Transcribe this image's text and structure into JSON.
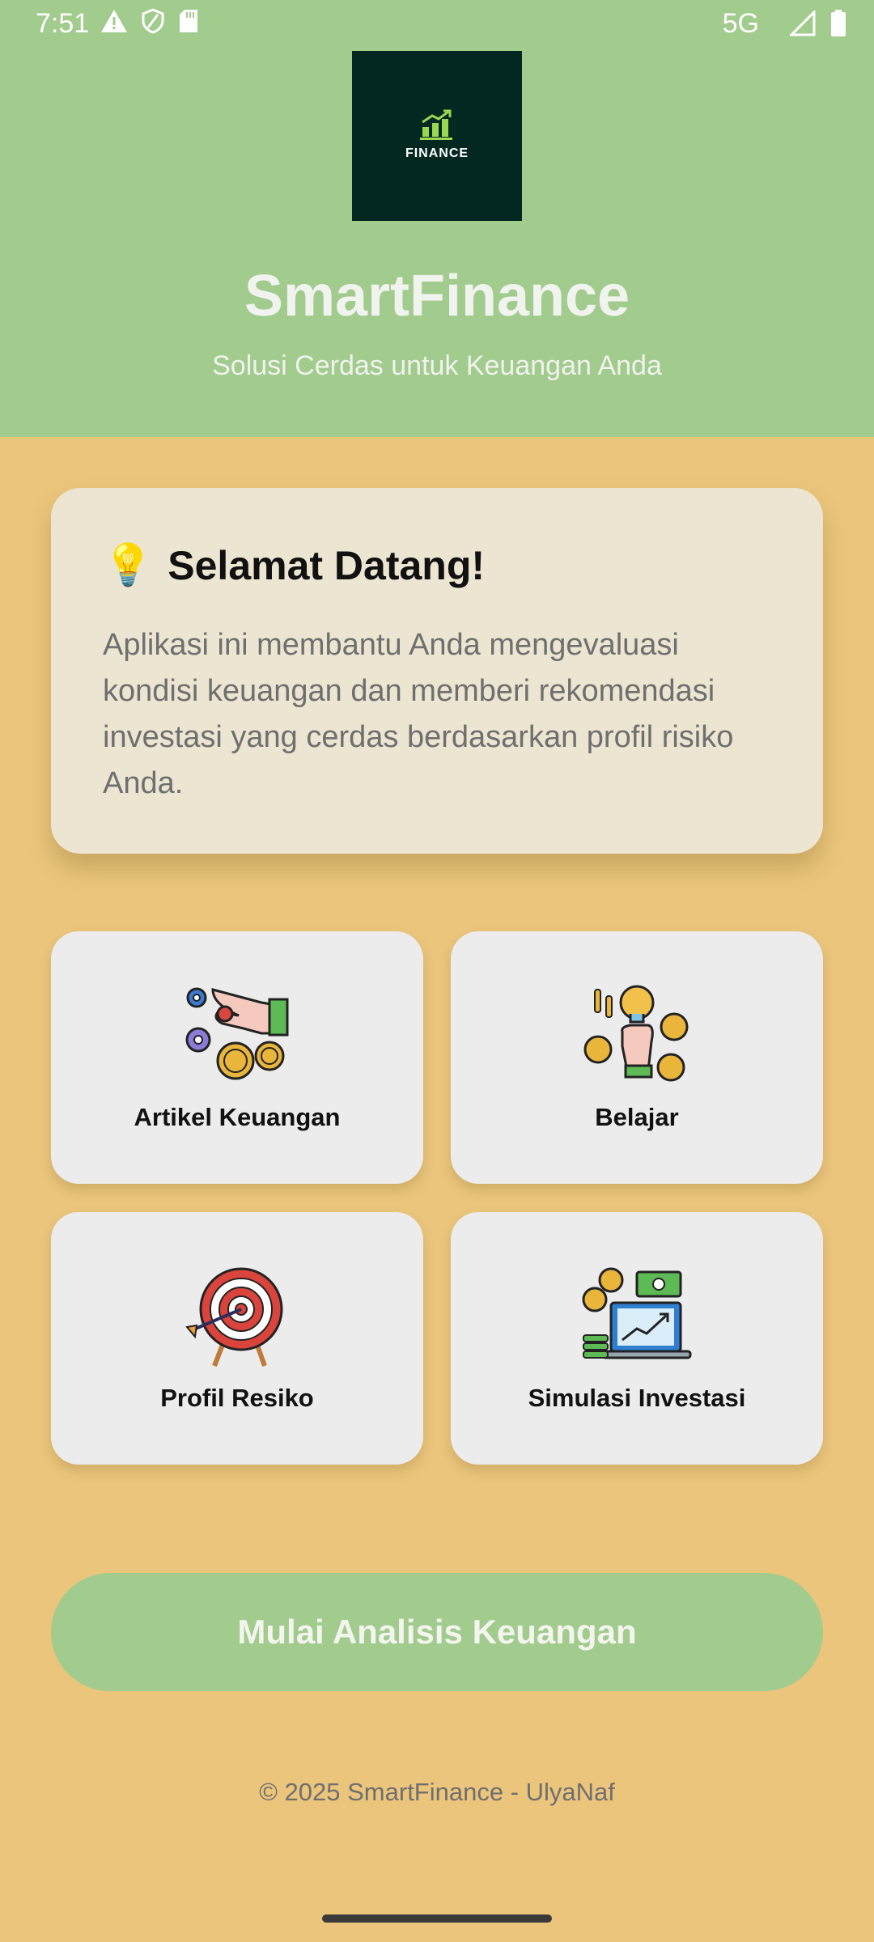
{
  "status_bar": {
    "time": "7:51",
    "network": "5G",
    "icons_left": [
      "warning-icon",
      "shield-icon",
      "sd-card-icon"
    ],
    "icons_right": [
      "signal-icon",
      "battery-icon"
    ]
  },
  "header": {
    "logo_text": "FINANCE",
    "title": "SmartFinance",
    "subtitle": "Solusi Cerdas untuk Keuangan Anda",
    "background": "#A2CB8E"
  },
  "welcome": {
    "emoji": "💡",
    "title": "Selamat Datang!",
    "body": "Aplikasi ini membantu Anda mengevaluasi kondisi keuangan dan memberi rekomendasi investasi yang cerdas berdasarkan profil risiko Anda."
  },
  "features": [
    {
      "label": "Artikel Keuangan",
      "icon": "hand-coins-gears-icon"
    },
    {
      "label": "Belajar",
      "icon": "lightbulb-coins-icon"
    },
    {
      "label": "Profil Resiko",
      "icon": "target-icon"
    },
    {
      "label": "Simulasi Investasi",
      "icon": "laptop-chart-icon"
    }
  ],
  "cta_label": "Mulai Analisis Keuangan",
  "footer": "© 2025 SmartFinance - UlyaNaf",
  "colors": {
    "background": "#EBC57C",
    "accent_green": "#A2CB8E",
    "logo_bg": "#032721"
  }
}
